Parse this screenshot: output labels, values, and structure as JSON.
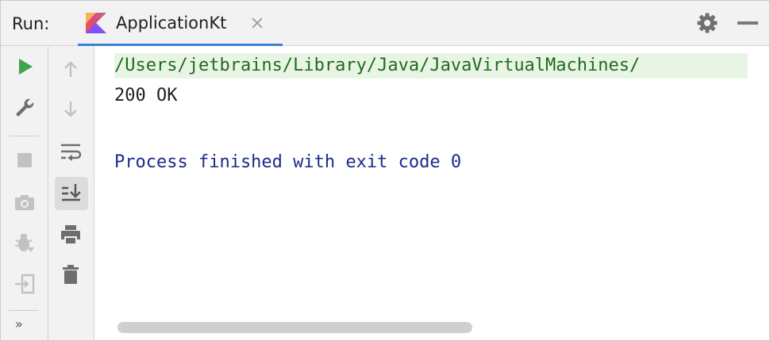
{
  "header": {
    "run_label": "Run:",
    "tab_title": "ApplicationKt",
    "tab_close_glyph": "✕"
  },
  "toolbar": {
    "more_label": "»"
  },
  "console": {
    "lines": [
      "/Users/jetbrains/Library/Java/JavaVirtualMachines/",
      "200 OK",
      "Process finished with exit code 0"
    ]
  },
  "colors": {
    "accent": "#3d81d6",
    "run_green": "#3fa34d",
    "path_bg": "#e9f5e4",
    "path_text": "#1f6b1f",
    "exit_text": "#1e2a8a"
  },
  "icons": [
    "kotlin-icon",
    "close-icon",
    "gear-icon",
    "minimize-icon",
    "run-icon",
    "wrench-icon",
    "stop-icon",
    "camera-icon",
    "debug-icon",
    "login-icon",
    "arrow-up-icon",
    "arrow-down-icon",
    "soft-wrap-icon",
    "scroll-to-end-icon",
    "print-icon",
    "trash-icon"
  ]
}
